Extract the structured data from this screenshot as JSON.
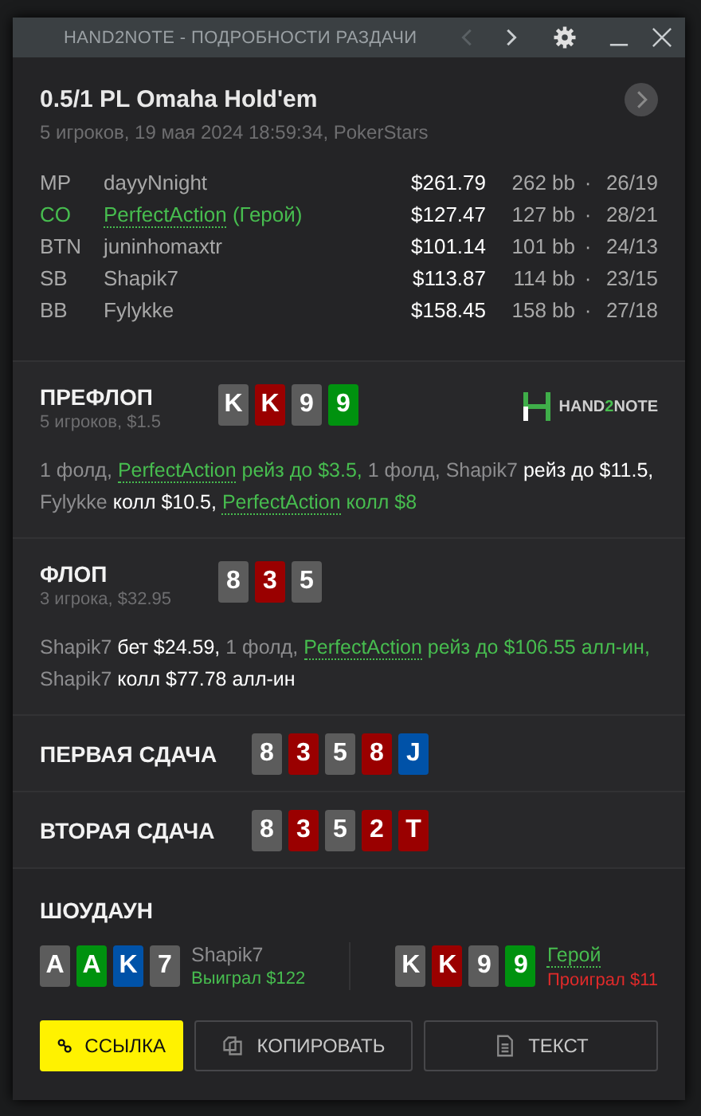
{
  "window": {
    "title": "HAND2NOTE - ПОДРОБНОСТИ РАЗДАЧИ",
    "nav": [
      {
        "kind": "prev",
        "disabled": true
      },
      {
        "kind": "next",
        "disabled": false
      }
    ]
  },
  "hand": {
    "title": "0.5/1 PL Omaha Hold'em",
    "subtitle": "5 игроков, 19 мая 2024 18:59:34, PokerStars"
  },
  "players": [
    {
      "position": "MP",
      "name": "dayyNnight",
      "hero": false,
      "stack": "$261.79",
      "bb": "262 bb",
      "sep": "·",
      "stats": "26/19"
    },
    {
      "position": "CO",
      "name": "PerfectAction",
      "hero": true,
      "hero_label": "(Герой)",
      "stack": "$127.47",
      "bb": "127 bb",
      "sep": "·",
      "stats": "28/21"
    },
    {
      "position": "BTN",
      "name": "juninhomaxtr",
      "hero": false,
      "stack": "$101.14",
      "bb": "101 bb",
      "sep": "·",
      "stats": "24/13"
    },
    {
      "position": "SB",
      "name": "Shapik7",
      "hero": false,
      "stack": "$113.87",
      "bb": "114 bb",
      "sep": "·",
      "stats": "23/15"
    },
    {
      "position": "BB",
      "name": "Fylykke",
      "hero": false,
      "stack": "$158.45",
      "bb": "158 bb",
      "sep": "·",
      "stats": "27/18"
    }
  ],
  "logo": {
    "start": "HAND",
    "accent": "2",
    "end": "NOTE"
  },
  "streets": [
    {
      "kind": "action",
      "name": "ПРЕФЛОП",
      "info": "5 игроков, $1.5",
      "logo": true,
      "cards": [
        {
          "rank": "K",
          "color": "#5c5c5c"
        },
        {
          "rank": "K",
          "color": "#9a0000"
        },
        {
          "rank": "9",
          "color": "#5c5c5c"
        },
        {
          "rank": "9",
          "color": "#00920f"
        }
      ],
      "actions": [
        {
          "text": "1 фолд,",
          "kind": "muted"
        },
        {
          "text": "PerfectAction",
          "kind": "hero"
        },
        {
          "text": "рейз до $3.5,",
          "kind": "hero_action"
        },
        {
          "text": "1 фолд,",
          "kind": "muted"
        },
        {
          "text": "Shapik7",
          "kind": "muted"
        },
        {
          "text": "рейз до $11.5,",
          "kind": "action"
        },
        {
          "text": "Fylykke",
          "kind": "muted"
        },
        {
          "text": "колл $10.5,",
          "kind": "action"
        },
        {
          "text": "PerfectAction",
          "kind": "hero"
        },
        {
          "text": "колл $8",
          "kind": "hero_action"
        }
      ]
    },
    {
      "kind": "action",
      "name": "ФЛОП",
      "info": "3 игрока, $32.95",
      "logo": false,
      "cards": [
        {
          "rank": "8",
          "color": "#5c5c5c"
        },
        {
          "rank": "3",
          "color": "#9a0000"
        },
        {
          "rank": "5",
          "color": "#5c5c5c"
        }
      ],
      "actions": [
        {
          "text": "Shapik7",
          "kind": "muted"
        },
        {
          "text": "бет $24.59,",
          "kind": "action"
        },
        {
          "text": "1 фолд,",
          "kind": "muted"
        },
        {
          "text": "PerfectAction",
          "kind": "hero"
        },
        {
          "text": "рейз до $106.55 алл-ин,",
          "kind": "hero_action"
        },
        {
          "text": "Shapik7",
          "kind": "muted"
        },
        {
          "text": "колл $77.78 алл-ин",
          "kind": "action"
        }
      ]
    },
    {
      "kind": "board",
      "name": "ПЕРВАЯ СДАЧА",
      "cards": [
        {
          "rank": "8",
          "color": "#5c5c5c"
        },
        {
          "rank": "3",
          "color": "#9a0000"
        },
        {
          "rank": "5",
          "color": "#5c5c5c"
        },
        {
          "rank": "8",
          "color": "#9a0000"
        },
        {
          "rank": "J",
          "color": "#0052a8"
        }
      ]
    },
    {
      "kind": "board",
      "name": "ВТОРАЯ СДАЧА",
      "cards": [
        {
          "rank": "8",
          "color": "#5c5c5c"
        },
        {
          "rank": "3",
          "color": "#9a0000"
        },
        {
          "rank": "5",
          "color": "#5c5c5c"
        },
        {
          "rank": "2",
          "color": "#9a0000"
        },
        {
          "rank": "T",
          "color": "#9a0000"
        }
      ]
    }
  ],
  "showdown": {
    "title": "ШОУДАУН",
    "hands": [
      {
        "cards": [
          {
            "rank": "A",
            "color": "#5c5c5c"
          },
          {
            "rank": "A",
            "color": "#00920f"
          },
          {
            "rank": "K",
            "color": "#0052a8"
          },
          {
            "rank": "7",
            "color": "#5c5c5c"
          }
        ],
        "player": "Shapik7",
        "hero": false,
        "won": true,
        "result": "Выиграл $122"
      },
      {
        "cards": [
          {
            "rank": "K",
            "color": "#5c5c5c"
          },
          {
            "rank": "K",
            "color": "#9a0000"
          },
          {
            "rank": "9",
            "color": "#5c5c5c"
          },
          {
            "rank": "9",
            "color": "#00920f"
          }
        ],
        "player": "Герой",
        "hero": true,
        "won": false,
        "result": "Проиграл $11"
      }
    ]
  },
  "buttons": [
    {
      "kind": "link",
      "label": "ССЫЛКА",
      "primary": true
    },
    {
      "kind": "copy",
      "label": "КОПИРОВАТЬ",
      "primary": false
    },
    {
      "kind": "text",
      "label": "ТЕКСТ",
      "primary": false
    }
  ]
}
